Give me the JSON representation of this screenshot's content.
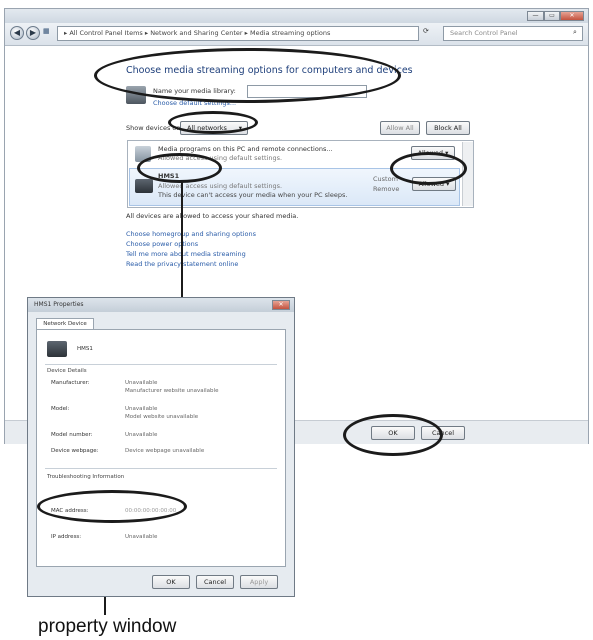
{
  "window": {
    "caption_buttons": [
      "—",
      "▭",
      "✕"
    ],
    "breadcrumb": "▸ All Control Panel Items ▸ Network and Sharing Center ▸ Media streaming options",
    "search_placeholder": "Search Control Panel"
  },
  "main": {
    "heading": "Choose media streaming options for computers and devices",
    "library_name_label": "Name your media library:",
    "choose_default": "Choose default settings...",
    "show_devices_label": "Show devices on:",
    "network_select": "All networks",
    "allow_all": "Allow All",
    "block_all": "Block All",
    "devices": [
      {
        "name": "Media programs on this PC and remote connections...",
        "sub": "Allowed access using default settings.",
        "status": "Allowed"
      },
      {
        "name": "HMS1",
        "sub1": "Allowed access using default settings.",
        "sub2": "This device can't access your media when your PC sleeps.",
        "side1": "Custom",
        "side2": "Remove",
        "status": "Allowed"
      }
    ],
    "access_note": "All devices are allowed to access your shared media.",
    "links": [
      "Choose homegroup and sharing options",
      "Choose power options",
      "Tell me more about media streaming",
      "Read the privacy statement online"
    ],
    "ok": "OK",
    "cancel": "Cancel"
  },
  "property_window": {
    "title": "HMS1 Properties",
    "tab": "Network Device",
    "device_name": "HMS1",
    "section_device": "Device Details",
    "rows": [
      {
        "label": "Manufacturer:",
        "value": "Unavailable",
        "value2": "Manufacturer website unavailable"
      },
      {
        "label": "Model:",
        "value": "Unavailable",
        "value2": "Model website unavailable"
      },
      {
        "label": "Model number:",
        "value": "Unavailable"
      },
      {
        "label": "Device webpage:",
        "value": "Device webpage unavailable"
      }
    ],
    "section_trouble": "Troubleshooting Information",
    "mac_label": "MAC address:",
    "mac_value": "00:00:00:00:00:00",
    "ip_label": "IP address:",
    "ip_value": "Unavailable",
    "ok": "OK",
    "cancel": "Cancel",
    "apply": "Apply"
  },
  "caption": "property window"
}
